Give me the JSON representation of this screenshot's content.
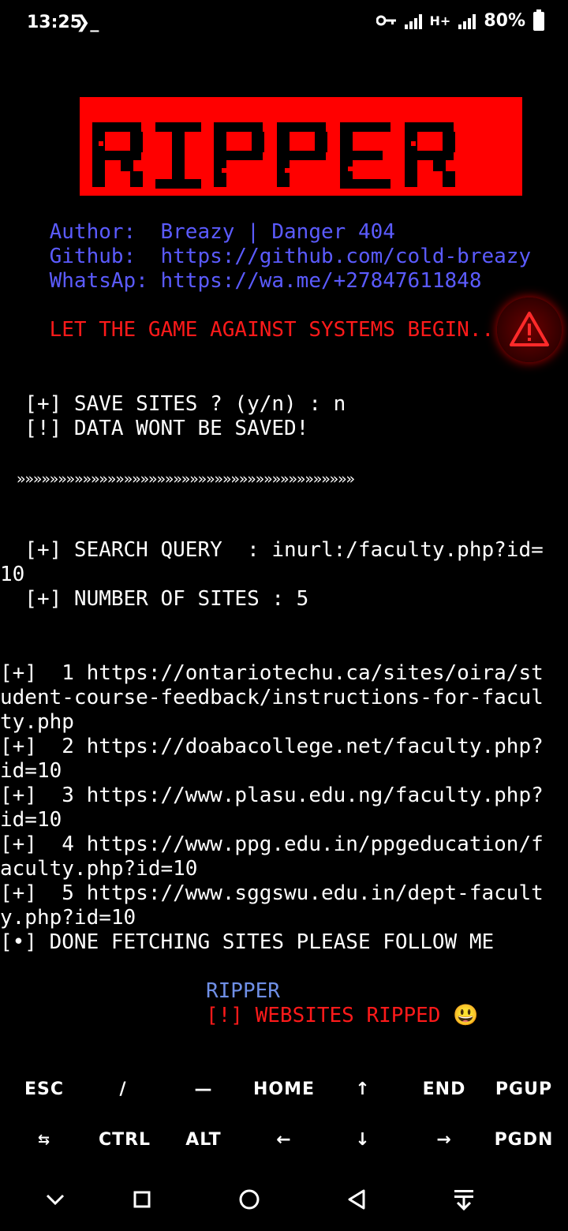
{
  "status_bar": {
    "time": "13:25",
    "prompt_icon": "terminal-prompt-icon",
    "network_label": "H+",
    "battery": "80%"
  },
  "banner": {
    "text": "RIPPER"
  },
  "info": {
    "author_line": "    Author:  Breazy | Danger 404",
    "github_line": "    Github:  https://github.com/cold-breazy",
    "whatsapp_line": "    WhatsAp: https://wa.me/+27847611848",
    "slogan": "    LET THE GAME AGAINST SYSTEMS BEGIN..."
  },
  "terminal": {
    "save_prompt": "  [+] SAVE SITES ? (y/n) : n",
    "save_result": "  [!] DATA WONT BE SAVED!",
    "divider": "  »»»»»»»»»»»»»»»»»»»»»»»»»»»»»»»»»»»»»»»»»",
    "query_1": "  [+] SEARCH QUERY  : inurl:/faculty.php?id=",
    "query_2": "10",
    "num_sites": "  [+] NUMBER OF SITES : 5",
    "results": [
      "[+]  1 https://ontariotechu.ca/sites/oira/st",
      "udent-course-feedback/instructions-for-facul",
      "ty.php",
      "[+]  2 https://doabacollege.net/faculty.php?",
      "id=10",
      "[+]  3 https://www.plasu.edu.ng/faculty.php?",
      "id=10",
      "[+]  4 https://www.ppg.edu.in/ppgeducation/f",
      "aculty.php?id=10",
      "[+]  5 https://www.sggswu.edu.in/dept-facult",
      "y.php?id=10",
      "[•] DONE FETCHING SITES PLEASE FOLLOW ME"
    ],
    "footer_title": "RIPPER",
    "footer_msg": "[!] WEBSITES RIPPED 😃"
  },
  "extra_keys": {
    "row1": [
      "ESC",
      "/",
      "—",
      "HOME",
      "↑",
      "END",
      "PGUP"
    ],
    "row2": [
      "⇆",
      "CTRL",
      "ALT",
      "←",
      "↓",
      "→",
      "PGDN"
    ]
  },
  "colors": {
    "banner_red": "#ff0000",
    "info_blue": "#5b5bff",
    "alert_red": "#ff1a1a"
  }
}
